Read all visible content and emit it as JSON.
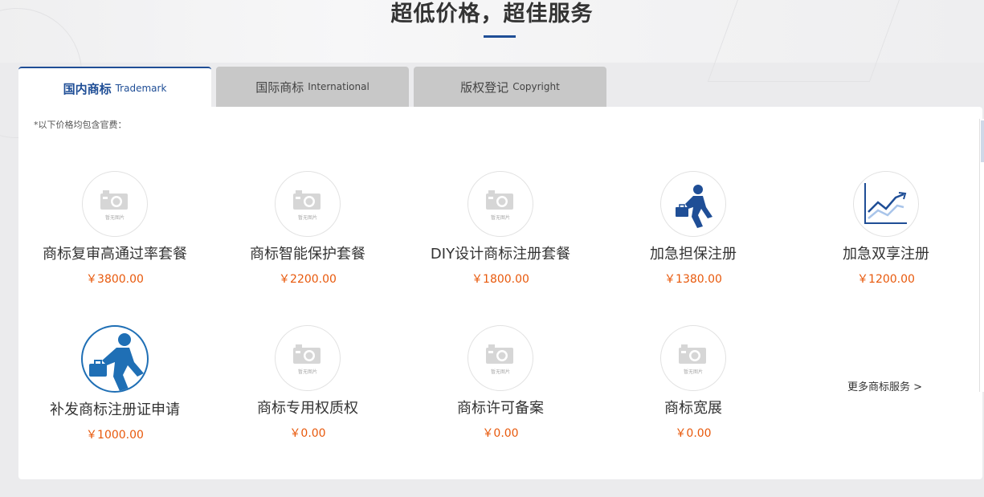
{
  "section": {
    "title": "超低价格，超佳服务"
  },
  "tabs": [
    {
      "zh": "国内商标",
      "en": "Trademark",
      "active": true
    },
    {
      "zh": "国际商标",
      "en": "International",
      "active": false
    },
    {
      "zh": "版权登记",
      "en": "Copyright",
      "active": false
    }
  ],
  "note": "*以下价格均包含官费：",
  "placeholder_text": "暂无图片",
  "items": [
    {
      "name": "商标复审高通过率套餐",
      "price": "￥3800.00",
      "icon": "no-image-icon"
    },
    {
      "name": "商标智能保护套餐",
      "price": "￥2200.00",
      "icon": "no-image-icon"
    },
    {
      "name": "DIY设计商标注册套餐",
      "price": "￥1800.00",
      "icon": "no-image-icon"
    },
    {
      "name": "加急担保注册",
      "price": "￥1380.00",
      "icon": "running-man-icon"
    },
    {
      "name": "加急双享注册",
      "price": "￥1200.00",
      "icon": "growth-chart-icon"
    },
    {
      "name": "补发商标注册证申请",
      "price": "￥1000.00",
      "icon": "running-man-icon"
    },
    {
      "name": "商标专用权质权",
      "price": "￥0.00",
      "icon": "no-image-icon"
    },
    {
      "name": "商标许可备案",
      "price": "￥0.00",
      "icon": "no-image-icon"
    },
    {
      "name": "商标宽展",
      "price": "￥0.00",
      "icon": "no-image-icon"
    }
  ],
  "more_link": "更多商标服务 >",
  "colors": {
    "accent": "#1f4e96",
    "price": "#e8590c"
  }
}
